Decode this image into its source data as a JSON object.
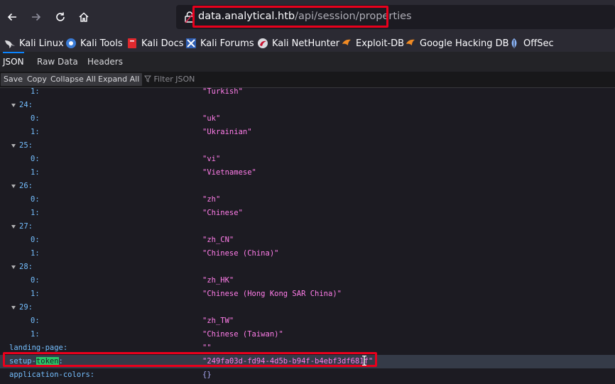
{
  "browser": {
    "url_host": "data.analytical.htb",
    "url_path": "/api/session/properties",
    "bookmarks": [
      "Kali Linux",
      "Kali Tools",
      "Kali Docs",
      "Kali Forums",
      "Kali NetHunter",
      "Exploit-DB",
      "Google Hacking DB",
      "OffSec"
    ]
  },
  "viewer": {
    "tabs": [
      "JSON",
      "Raw Data",
      "Headers"
    ],
    "toolbar": [
      "Save",
      "Copy",
      "Collapse All",
      "Expand All"
    ],
    "filter_placeholder": "Filter JSON"
  },
  "json_rows": [
    {
      "key": "1:",
      "value": "\"Turkish\""
    },
    {
      "key": "24:"
    },
    {
      "key": "0:",
      "value": "\"uk\""
    },
    {
      "key": "1:",
      "value": "\"Ukrainian\""
    },
    {
      "key": "25:"
    },
    {
      "key": "0:",
      "value": "\"vi\""
    },
    {
      "key": "1:",
      "value": "\"Vietnamese\""
    },
    {
      "key": "26:"
    },
    {
      "key": "0:",
      "value": "\"zh\""
    },
    {
      "key": "1:",
      "value": "\"Chinese\""
    },
    {
      "key": "27:"
    },
    {
      "key": "0:",
      "value": "\"zh_CN\""
    },
    {
      "key": "1:",
      "value": "\"Chinese (China)\""
    },
    {
      "key": "28:"
    },
    {
      "key": "0:",
      "value": "\"zh_HK\""
    },
    {
      "key": "1:",
      "value": "\"Chinese (Hong Kong SAR China)\""
    },
    {
      "key": "29:"
    },
    {
      "key": "0:",
      "value": "\"zh_TW\""
    },
    {
      "key": "1:",
      "value": "\"Chinese (Taiwan)\""
    },
    {
      "key": "landing-page:",
      "value": "\"\""
    },
    {
      "key_prefix": "setup-",
      "key_match": "token",
      "key_suffix": ":",
      "value": "\"249fa03d-fd94-4d5b-b94f-b4ebf3df681f\""
    },
    {
      "key": "application-colors:",
      "value": "{}"
    }
  ],
  "colors": {
    "annotation_red": "#e8001c",
    "json_key": "#75bfff",
    "json_string": "#ff7de9",
    "filter_match": "#2ac769"
  },
  "icons": {
    "nav": [
      "back-arrow-icon",
      "forward-arrow-icon",
      "reload-icon",
      "home-icon"
    ],
    "url": "lock-icon",
    "filter": "funnel-icon"
  }
}
